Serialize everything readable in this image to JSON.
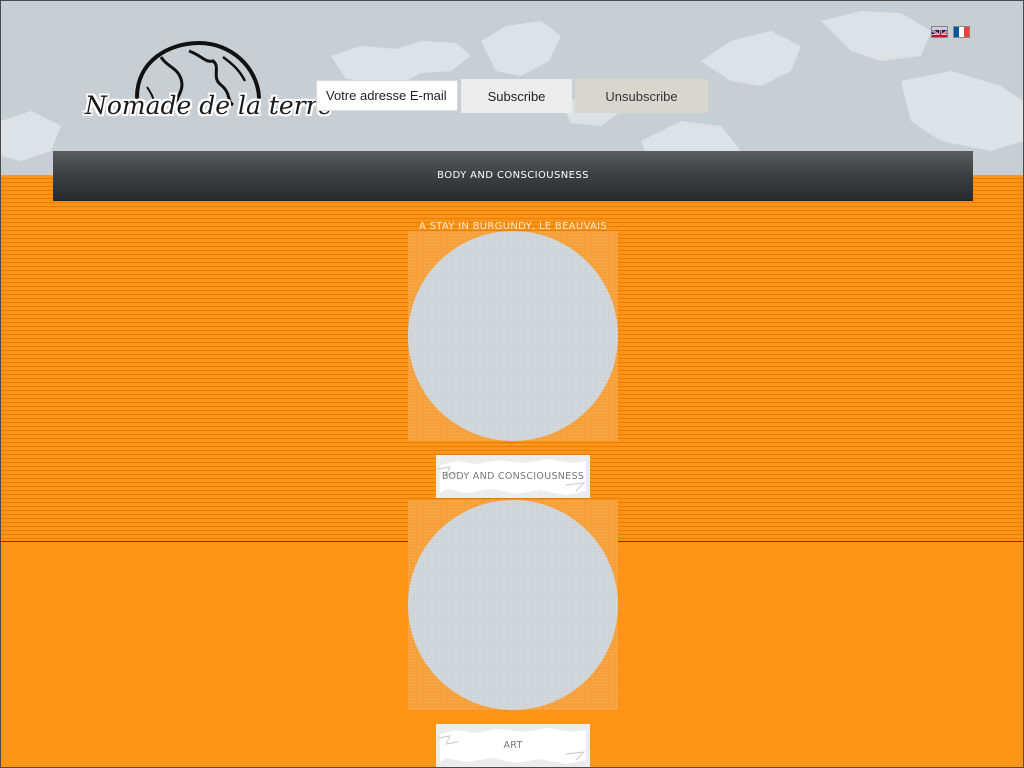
{
  "header": {
    "logo_text": "Nomade de la terre",
    "email_placeholder": "Votre adresse E-mail",
    "subscribe_label": "Subscribe",
    "unsubscribe_label": "Unsubscribe"
  },
  "languages": [
    {
      "code": "en",
      "icon": "uk-flag-icon"
    },
    {
      "code": "fr",
      "icon": "france-flag-icon"
    }
  ],
  "nav": {
    "items": [
      {
        "label": "BODY AND CONSCIOUSNESS"
      }
    ]
  },
  "posts": [
    {
      "title": "A STAY IN BURGUNDY, LE BEAUVAIS",
      "category": "BODY AND CONSCIOUSNESS"
    },
    {
      "title": "",
      "category": "ART"
    }
  ],
  "colors": {
    "background_orange": "#ff9416",
    "header_grey": "#c8cfd4",
    "navbar_dark": "#3f4144",
    "post_placeholder": "#cdd3d7"
  }
}
